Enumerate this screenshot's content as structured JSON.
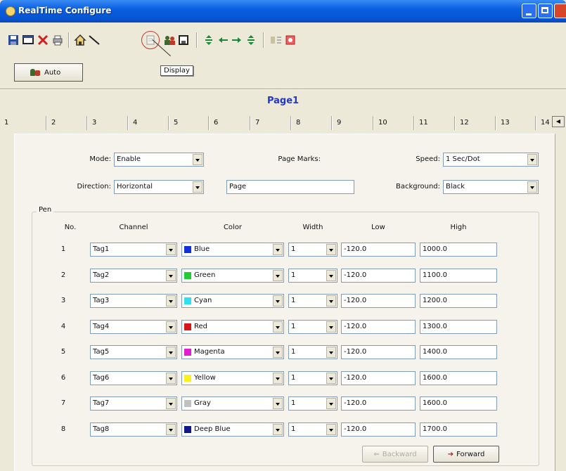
{
  "window": {
    "title": "RealTime Configure"
  },
  "toolbar": {
    "icons": [
      "save-icon",
      "window-icon",
      "delete-icon",
      "print-icon",
      "home-icon",
      "line-icon",
      "display-icon",
      "users-icon",
      "disk-icon",
      "move-vertical-icon",
      "move-left-icon",
      "move-right-icon",
      "move-vertical-icon",
      "properties-icon",
      "config-icon"
    ],
    "tooltip": "Display"
  },
  "auto_button": {
    "label": "Auto"
  },
  "page": {
    "title": "Page1"
  },
  "tabs": [
    "1",
    "2",
    "3",
    "4",
    "5",
    "6",
    "7",
    "8",
    "9",
    "10",
    "11",
    "12",
    "13",
    "14"
  ],
  "form": {
    "mode_label": "Mode:",
    "mode_value": "Enable",
    "page_marks_label": "Page Marks:",
    "speed_label": "Speed:",
    "speed_value": "1 Sec/Dot",
    "direction_label": "Direction:",
    "direction_value": "Horizontal",
    "page_marks_value": "Page",
    "background_label": "Background:",
    "background_value": "Black"
  },
  "pen": {
    "legend": "Pen",
    "headers": {
      "no": "No.",
      "channel": "Channel",
      "color": "Color",
      "width": "Width",
      "low": "Low",
      "high": "High"
    },
    "rows": [
      {
        "no": "1",
        "channel": "Tag1",
        "color": "Blue",
        "swatch": "#1030d8",
        "width": "1",
        "low": "-120.0",
        "high": "1000.0"
      },
      {
        "no": "2",
        "channel": "Tag2",
        "color": "Green",
        "swatch": "#22cc33",
        "width": "1",
        "low": "-120.0",
        "high": "1100.0"
      },
      {
        "no": "3",
        "channel": "Tag3",
        "color": "Cyan",
        "swatch": "#30e0f0",
        "width": "1",
        "low": "-120.0",
        "high": "1200.0"
      },
      {
        "no": "4",
        "channel": "Tag4",
        "color": "Red",
        "swatch": "#d81818",
        "width": "1",
        "low": "-120.0",
        "high": "1300.0"
      },
      {
        "no": "5",
        "channel": "Tag5",
        "color": "Magenta",
        "swatch": "#e020d0",
        "width": "1",
        "low": "-120.0",
        "high": "1400.0"
      },
      {
        "no": "6",
        "channel": "Tag6",
        "color": "Yellow",
        "swatch": "#f8f020",
        "width": "1",
        "low": "-120.0",
        "high": "1600.0"
      },
      {
        "no": "7",
        "channel": "Tag7",
        "color": "Gray",
        "swatch": "#c0c0c0",
        "width": "1",
        "low": "-120.0",
        "high": "1600.0"
      },
      {
        "no": "8",
        "channel": "Tag8",
        "color": "Deep Blue",
        "swatch": "#101888",
        "width": "1",
        "low": "-120.0",
        "high": "1700.0"
      }
    ]
  },
  "nav": {
    "backward": "Backward",
    "forward": "Forward"
  }
}
